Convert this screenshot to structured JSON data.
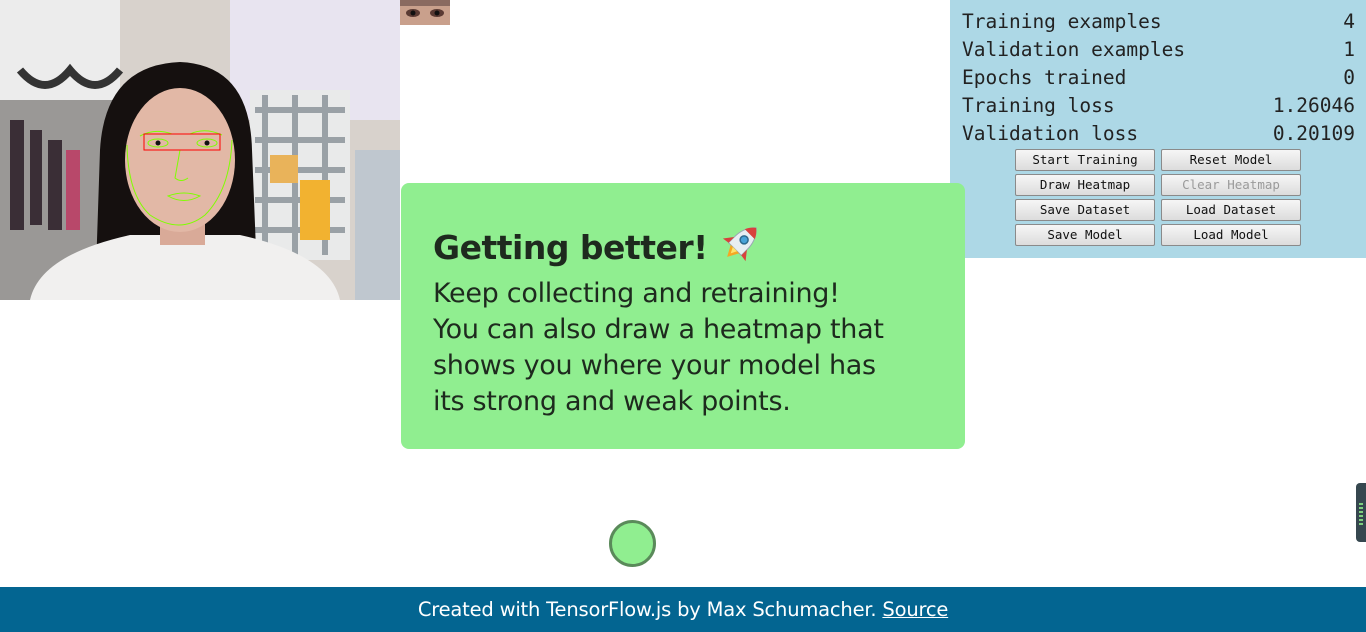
{
  "stats": [
    {
      "label": "Training examples",
      "value": "4"
    },
    {
      "label": "Validation examples",
      "value": "1"
    },
    {
      "label": "Epochs trained",
      "value": "0"
    },
    {
      "label": "Training loss",
      "value": "1.26046"
    },
    {
      "label": "Validation loss",
      "value": "0.20109"
    }
  ],
  "buttons": {
    "start_training": "Start Training",
    "reset_model": "Reset Model",
    "draw_heatmap": "Draw Heatmap",
    "clear_heatmap": "Clear Heatmap",
    "save_dataset": "Save Dataset",
    "load_dataset": "Load Dataset",
    "save_model": "Save Model",
    "load_model": "Load Model"
  },
  "card": {
    "title": "Getting better!",
    "title_icon": "rocket-icon",
    "text_lines": [
      "Keep collecting and retraining!",
      "You can also draw a heatmap that",
      "shows you where your model has",
      "its strong and weak points."
    ]
  },
  "footer": {
    "text": "Created with TensorFlow.js by Max Schumacher.",
    "link": "Source"
  },
  "colors": {
    "panel_bg": "#add8e6",
    "card_bg": "#90ee90",
    "footer_bg": "#036591",
    "face_overlay": "#7fff00",
    "eye_box": "#ff0000"
  }
}
